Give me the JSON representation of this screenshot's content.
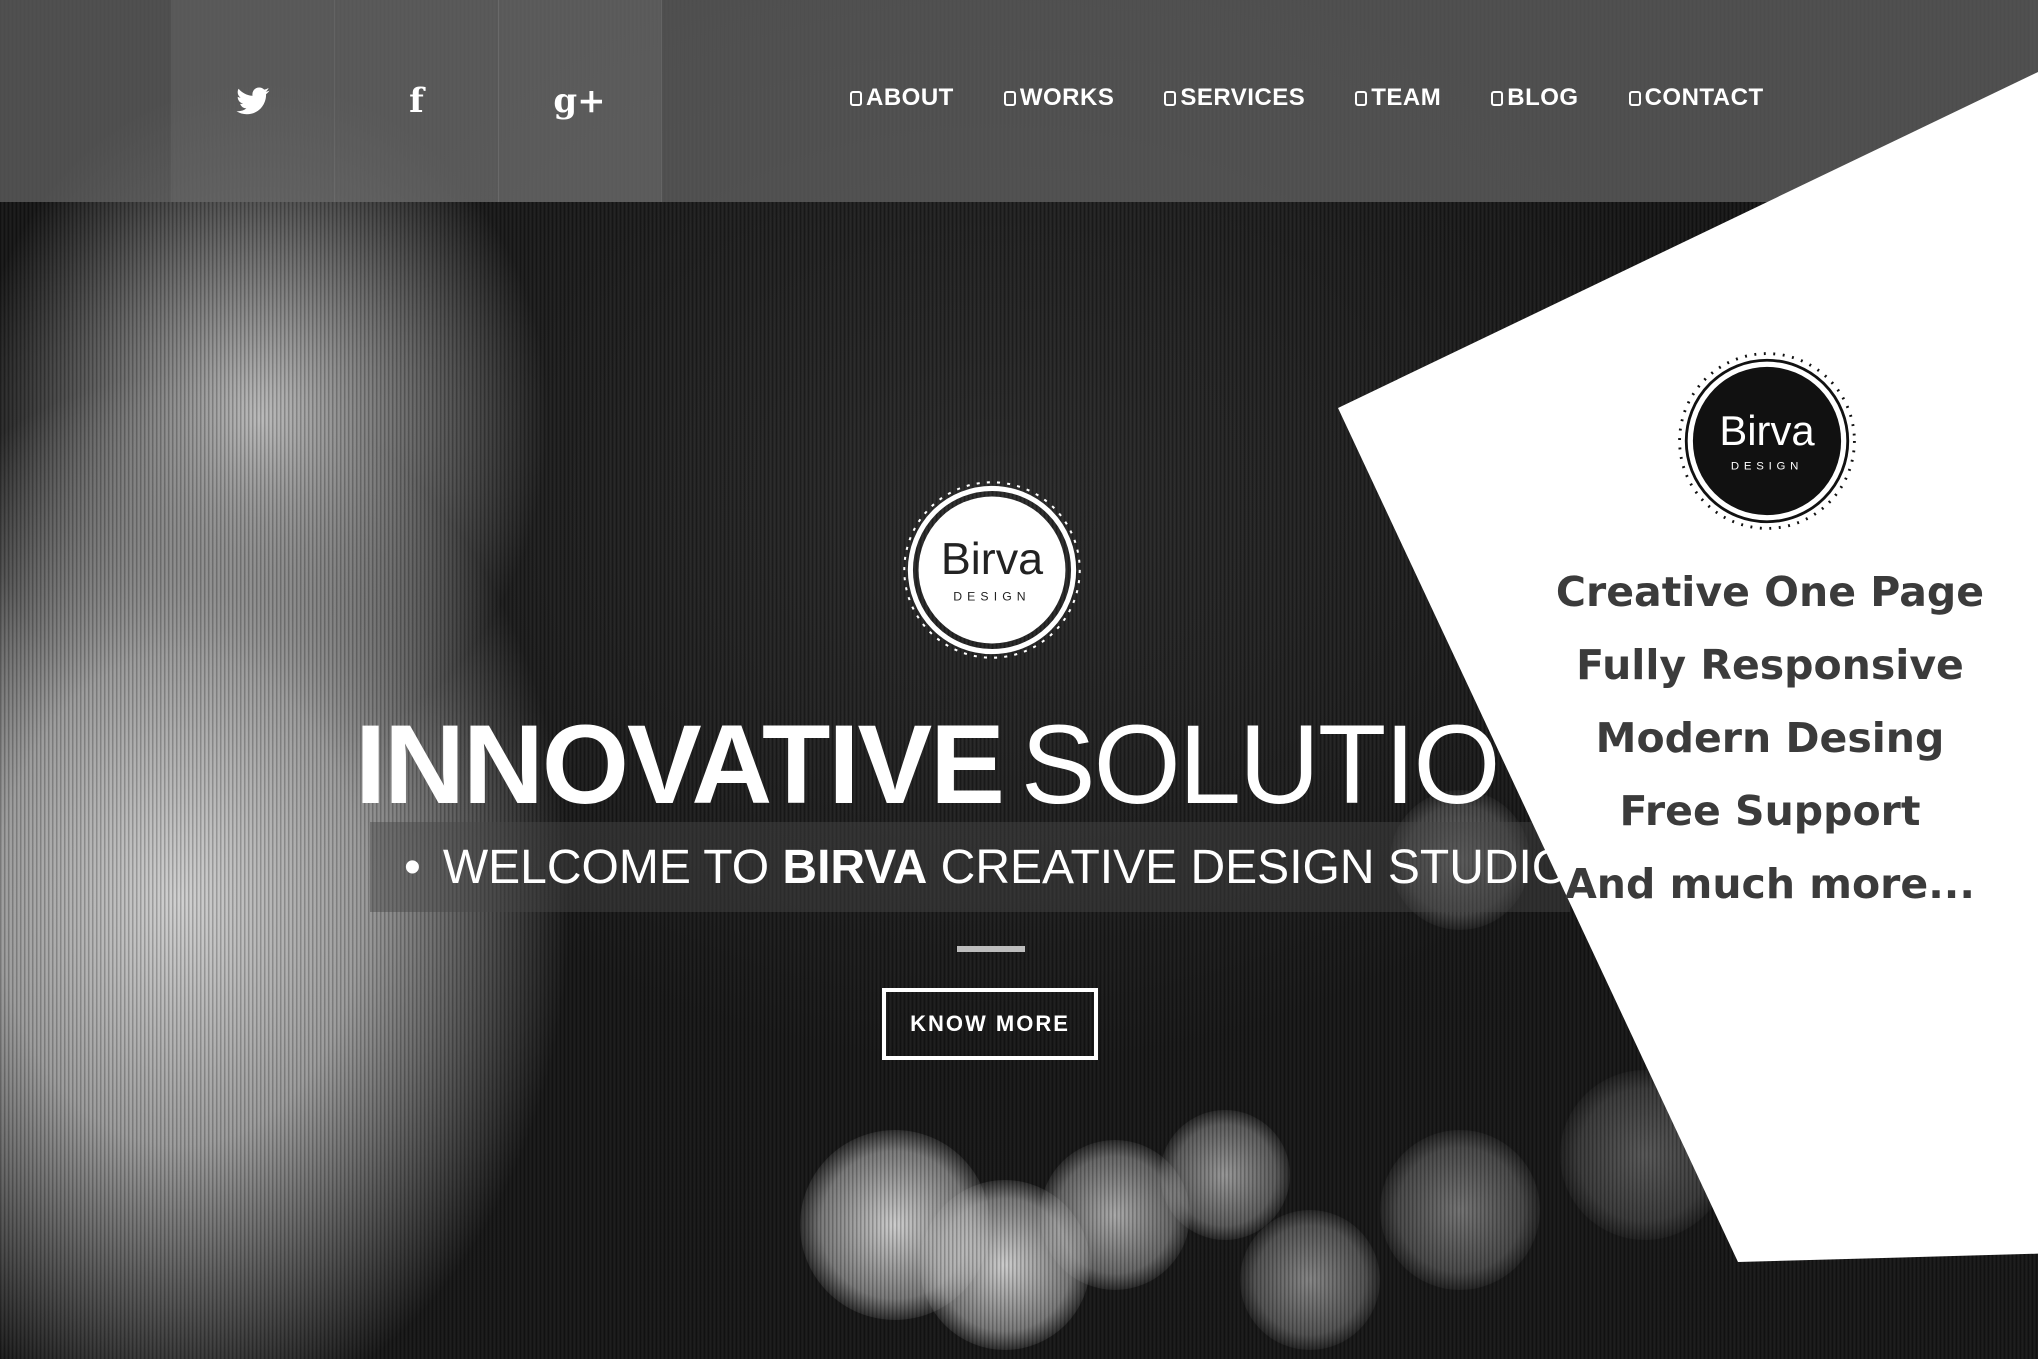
{
  "social": {
    "items": [
      {
        "name": "twitter-icon"
      },
      {
        "name": "facebook-icon",
        "glyph": "f"
      },
      {
        "name": "google-plus-icon",
        "glyph": "g+"
      }
    ]
  },
  "nav": {
    "items": [
      "ABOUT",
      "WORKS",
      "SERVICES",
      "TEAM",
      "BLOG",
      "CONTACT"
    ]
  },
  "hero": {
    "logo": {
      "word": "Birva",
      "sub": "DESIGN"
    },
    "headline_bold": "INNOVATIVE",
    "headline_light": "SOLUTIO",
    "tagline_bullet": "•",
    "tagline_pre": "WELCOME TO ",
    "tagline_brand": "BIRVA",
    "tagline_post": " CREATIVE DESIGN STUDIO",
    "cta_label": "KNOW MORE"
  },
  "promo": {
    "logo": {
      "word": "Birva",
      "sub": "DESIGN"
    },
    "features": [
      "Creative One Page",
      "Fully Responsive",
      "Modern Desing",
      "Free Support",
      "And much more..."
    ]
  },
  "colors": {
    "topbar": "#5f5f5f",
    "text_light": "#ffffff",
    "card_bg": "#ffffff",
    "card_text": "#3b3b3b"
  }
}
